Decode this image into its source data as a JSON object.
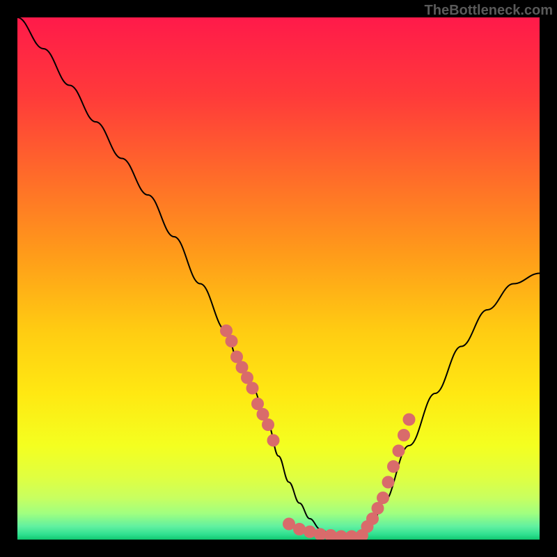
{
  "watermark": "TheBottleneck.com",
  "chart_data": {
    "type": "line",
    "title": "",
    "xlabel": "",
    "ylabel": "",
    "xlim": [
      0,
      100
    ],
    "ylim": [
      0,
      100
    ],
    "curve": {
      "x": [
        0,
        5,
        10,
        15,
        20,
        25,
        30,
        35,
        40,
        42,
        45,
        48,
        50,
        52,
        54,
        56,
        58,
        60,
        62,
        64,
        66,
        68,
        70,
        75,
        80,
        85,
        90,
        95,
        100
      ],
      "y": [
        100,
        94,
        87,
        80,
        73,
        66,
        58,
        49,
        40,
        35,
        29,
        22,
        16,
        11,
        7,
        4,
        2,
        1,
        0.5,
        0.5,
        1,
        3,
        7,
        18,
        28,
        37,
        44,
        49,
        51
      ]
    },
    "markers_left": {
      "x": [
        40,
        41,
        42,
        43,
        44,
        45,
        46,
        47,
        48,
        49
      ],
      "y": [
        40,
        38,
        35,
        33,
        31,
        29,
        26,
        24,
        22,
        19
      ]
    },
    "markers_bottom": {
      "x": [
        52,
        54,
        56,
        58,
        60,
        62,
        64,
        66
      ],
      "y": [
        3,
        2,
        1.5,
        1,
        0.8,
        0.6,
        0.6,
        0.8
      ]
    },
    "markers_right": {
      "x": [
        67,
        68,
        69,
        70,
        71,
        72,
        73,
        74,
        75
      ],
      "y": [
        2.5,
        4,
        6,
        8,
        11,
        14,
        17,
        20,
        23
      ]
    },
    "gradient_stops": [
      {
        "offset": 0,
        "color": "#ff1a4a"
      },
      {
        "offset": 0.15,
        "color": "#ff3a3a"
      },
      {
        "offset": 0.3,
        "color": "#ff6a2a"
      },
      {
        "offset": 0.45,
        "color": "#ff9a1a"
      },
      {
        "offset": 0.6,
        "color": "#ffcc12"
      },
      {
        "offset": 0.72,
        "color": "#ffe812"
      },
      {
        "offset": 0.82,
        "color": "#f4ff20"
      },
      {
        "offset": 0.88,
        "color": "#e0ff40"
      },
      {
        "offset": 0.92,
        "color": "#c8ff60"
      },
      {
        "offset": 0.95,
        "color": "#a0ff80"
      },
      {
        "offset": 0.975,
        "color": "#60f0a0"
      },
      {
        "offset": 0.99,
        "color": "#30e090"
      },
      {
        "offset": 1.0,
        "color": "#10c870"
      }
    ],
    "marker_color": "#d96b6b",
    "curve_color": "#000000"
  }
}
